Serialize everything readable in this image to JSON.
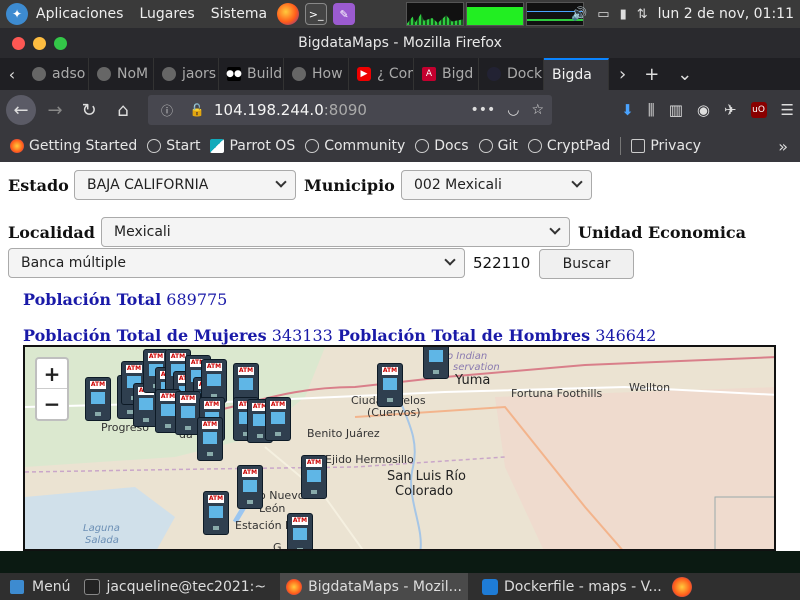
{
  "desktop": {
    "menus": [
      "Aplicaciones",
      "Lugares",
      "Sistema"
    ],
    "clock": "lun  2 de nov, 01:11"
  },
  "window": {
    "title": "BigdataMaps - Mozilla Firefox"
  },
  "tabs": [
    {
      "label": "adso",
      "active": false
    },
    {
      "label": "NoM",
      "active": false
    },
    {
      "label": "jaors",
      "active": false
    },
    {
      "label": "Build",
      "active": false
    },
    {
      "label": "How",
      "active": false
    },
    {
      "label": "¿ Cor",
      "active": false
    },
    {
      "label": "Bigd",
      "active": false
    },
    {
      "label": "Dock",
      "active": false
    },
    {
      "label": "Bigda",
      "active": true
    }
  ],
  "urlbar": {
    "host": "104.198.244.0",
    "port": ":8090"
  },
  "bookmarks": [
    "Getting Started",
    "Start",
    "Parrot OS",
    "Community",
    "Docs",
    "Git",
    "CryptPad",
    "Privacy"
  ],
  "form": {
    "estado_label": "Estado",
    "estado_value": "BAJA CALIFORNIA",
    "municipio_label": "Municipio",
    "municipio_value": "002 Mexicali",
    "localidad_label": "Localidad",
    "localidad_value": "Mexicali",
    "unidad_label": "Unidad Economica",
    "unidad_value": "Banca múltiple",
    "unidad_code": "522110",
    "buscar_label": "Buscar"
  },
  "stats": {
    "total_label": "Población Total",
    "total_value": "689775",
    "mujeres_label": "Población Total de Mujeres",
    "mujeres_value": "343133",
    "hombres_label": "Población Total de Hombres",
    "hombres_value": "346642"
  },
  "map": {
    "zoom_in": "+",
    "zoom_out": "−",
    "places": {
      "yuma": "Yuma",
      "fortuna": "Fortuna Foothills",
      "wellton": "Wellton",
      "progreso": "Progreso",
      "benito": "Benito Juárez",
      "ejido": "Ejido Hermosillo",
      "sanluis1": "San Luis Río",
      "sanluis2": "Colorado",
      "ciudad1": "Ciuda",
      "ciudad2": "relos",
      "cuervos": "(Cuervos)",
      "nuevo1": "o Nuevo",
      "nuevo2": "León",
      "estacion": "Estación De",
      "laguna1": "Laguna",
      "laguna2": "Salada",
      "reservation1": "o Indian",
      "reservation2": "servation",
      "mexicali_fragment": "da",
      "bottom_fragment": "G"
    }
  },
  "taskbar": {
    "menu": "Menú",
    "items": [
      {
        "label": "jacqueline@tec2021:~",
        "icon": "terminal-icon"
      },
      {
        "label": "BigdataMaps - Mozil...",
        "icon": "firefox-icon"
      },
      {
        "label": "Dockerfile - maps - V...",
        "icon": "vscode-icon"
      }
    ]
  }
}
